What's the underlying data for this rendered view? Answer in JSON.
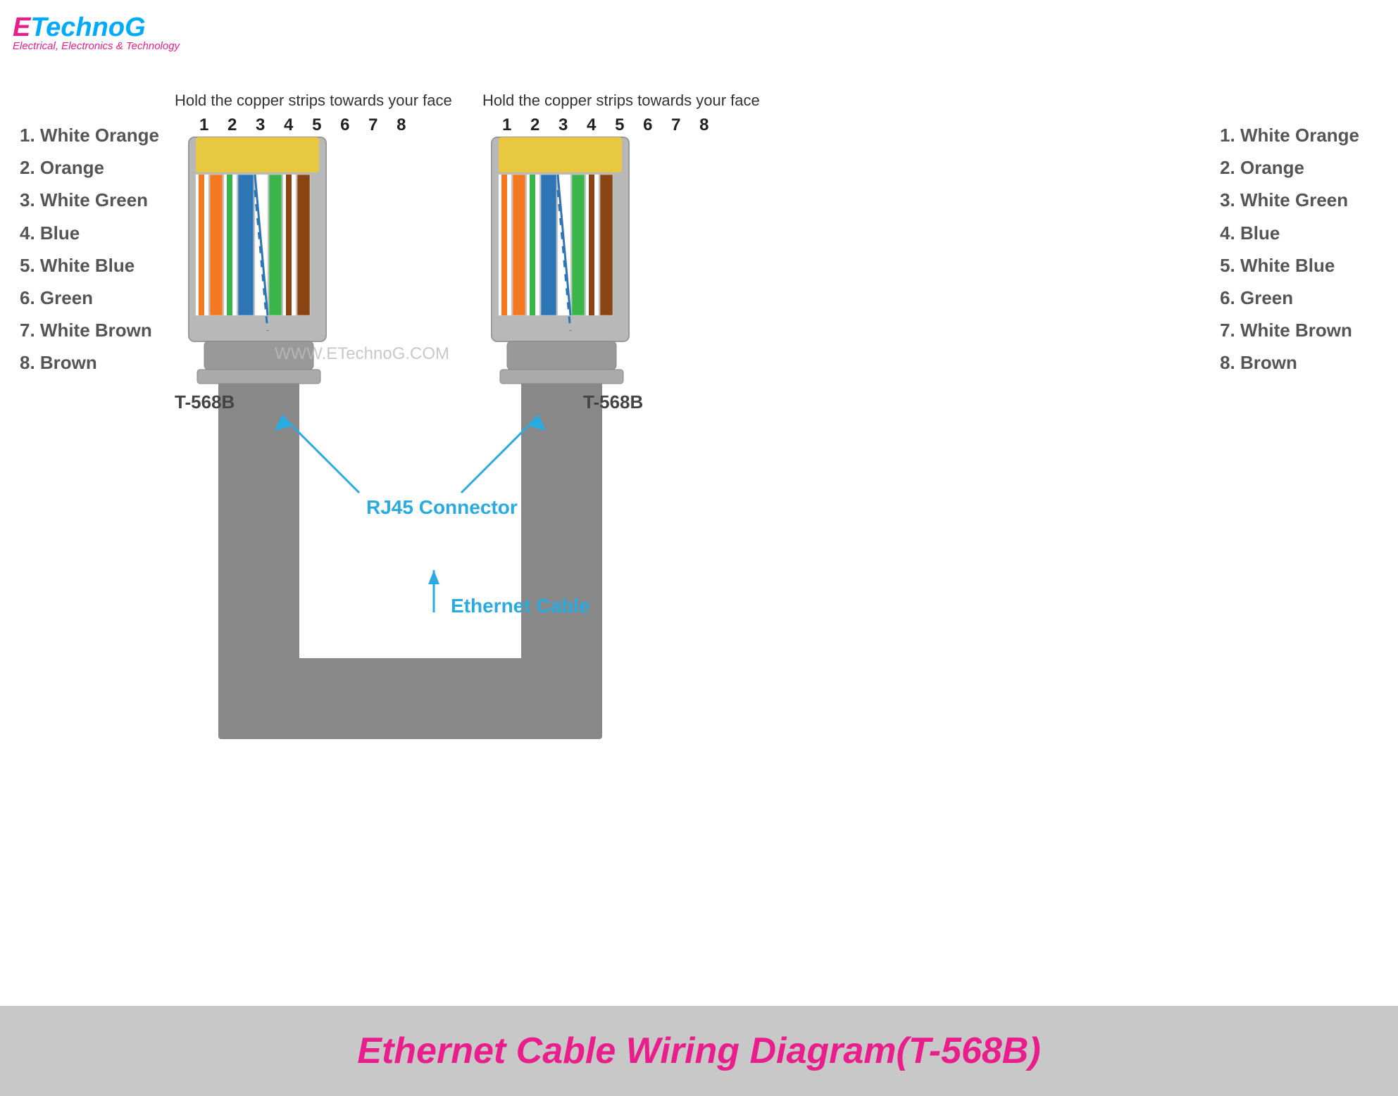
{
  "logo": {
    "e": "E",
    "technog": "TechnoG",
    "subtitle": "Electrical, Electronics & Technology"
  },
  "instruction": "Hold the copper strips towards your face",
  "pin_numbers": "1 2 3 4 5 6 7 8",
  "wire_labels": [
    "1. White Orange",
    "2. Orange",
    "3. White Green",
    "4. Blue",
    "5. White Blue",
    "6. Green",
    "7. White Brown",
    "8. Brown"
  ],
  "connector_label": "T-568B",
  "rj45_label": "RJ45 Connector",
  "ethernet_label": "Ethernet Cable",
  "watermark": "WWW.ETechnoG.COM",
  "bottom_banner": "Ethernet Cable Wiring Diagram(T-568B)",
  "colors": {
    "accent_pink": "#e91e8c",
    "accent_blue": "#29abe2",
    "wire_white_orange": "#fff",
    "wire_orange": "#f47920",
    "wire_white_green": "#fff",
    "wire_green": "#39b54a",
    "wire_blue": "#2e75b6",
    "wire_white_blue": "#fff",
    "wire_brown": "#8b4513",
    "wire_white_brown": "#fff",
    "connector_body": "#b0b0b0",
    "connector_gold": "#f5d020"
  }
}
